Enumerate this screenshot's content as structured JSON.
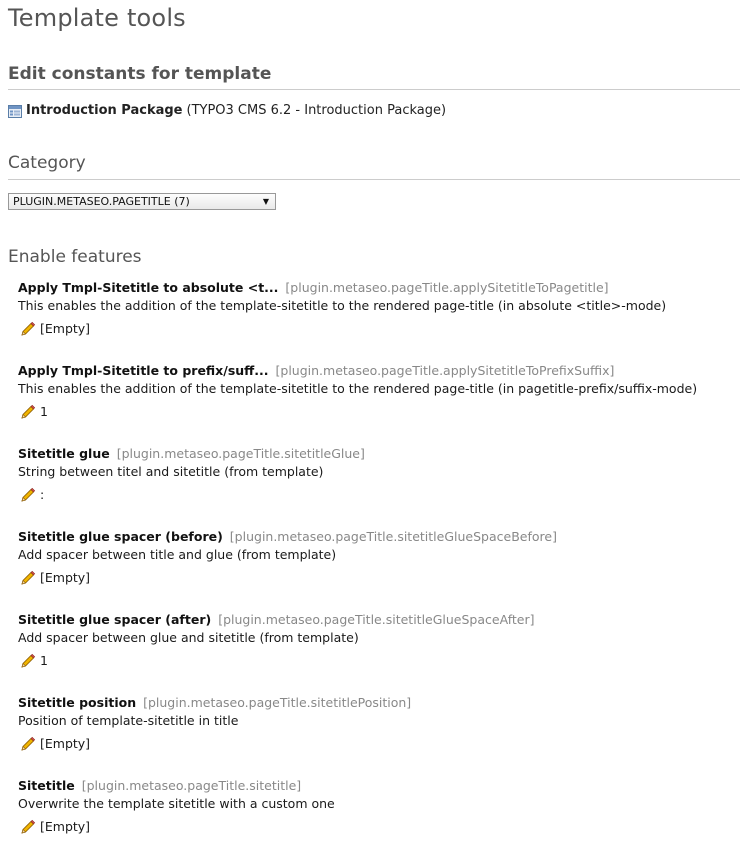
{
  "header": {
    "title": "Template tools",
    "subtitle": "Edit constants for template"
  },
  "template": {
    "name": "Introduction Package",
    "details": "(TYPO3 CMS 6.2 - Introduction Package)",
    "icon": "template-icon"
  },
  "category": {
    "heading": "Category",
    "selected": "PLUGIN.METASEO.PAGETITLE (7)"
  },
  "features": {
    "heading": "Enable features",
    "items": [
      {
        "label": "Apply Tmpl-Sitetitle to absolute <t...",
        "key": "[plugin.metaseo.pageTitle.applySitetitleToPagetitle]",
        "description": "This enables the addition of the template-sitetitle to the rendered page-title (in absolute <title>-mode)",
        "value": "[Empty]"
      },
      {
        "label": "Apply Tmpl-Sitetitle to prefix/suff...",
        "key": "[plugin.metaseo.pageTitle.applySitetitleToPrefixSuffix]",
        "description": "This enables the addition of the template-sitetitle to the rendered page-title (in pagetitle-prefix/suffix-mode)",
        "value": "1"
      },
      {
        "label": "Sitetitle glue",
        "key": "[plugin.metaseo.pageTitle.sitetitleGlue]",
        "description": "String between titel and sitetitle (from template)",
        "value": ":"
      },
      {
        "label": "Sitetitle glue spacer (before)",
        "key": "[plugin.metaseo.pageTitle.sitetitleGlueSpaceBefore]",
        "description": "Add spacer between title and glue (from template)",
        "value": "[Empty]"
      },
      {
        "label": "Sitetitle glue spacer (after)",
        "key": "[plugin.metaseo.pageTitle.sitetitleGlueSpaceAfter]",
        "description": "Add spacer between glue and sitetitle (from template)",
        "value": "1"
      },
      {
        "label": "Sitetitle position",
        "key": "[plugin.metaseo.pageTitle.sitetitlePosition]",
        "description": "Position of template-sitetitle in title",
        "value": "[Empty]"
      },
      {
        "label": "Sitetitle",
        "key": "[plugin.metaseo.pageTitle.sitetitle]",
        "description": "Overwrite the template sitetitle with a custom one",
        "value": "[Empty]"
      }
    ]
  },
  "icons": {
    "edit": "pencil-icon",
    "dropdown": "chevron-down-icon"
  }
}
